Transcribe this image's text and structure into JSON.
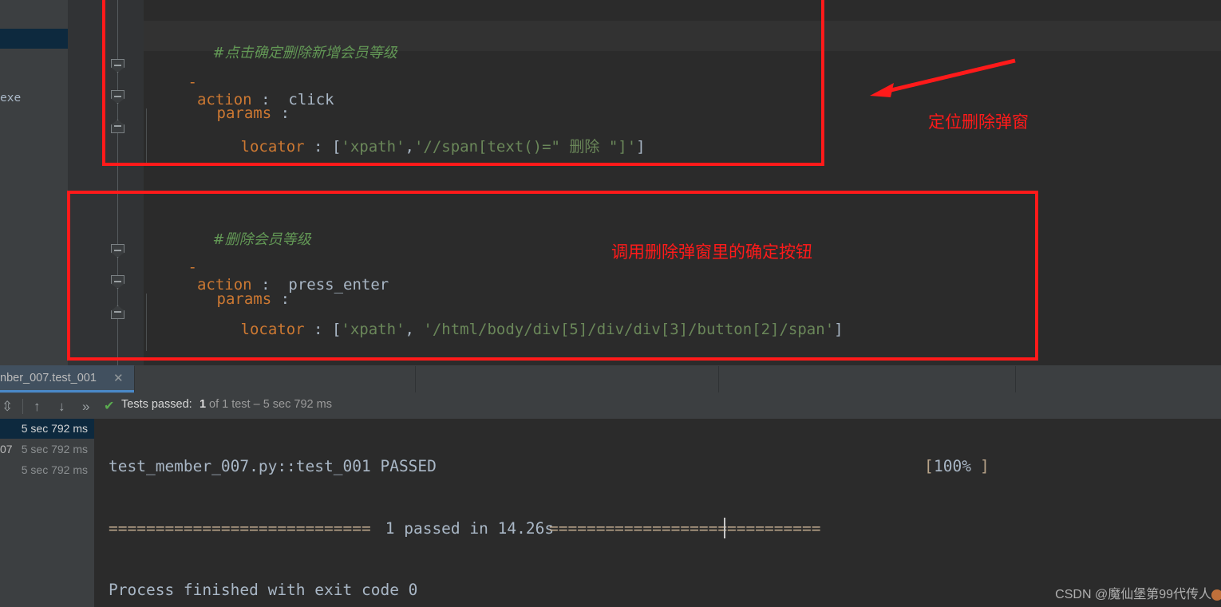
{
  "editor": {
    "left_panel_text": "exe",
    "blocks": [
      {
        "comment": "#点击确定删除新增会员等级",
        "action_key": "action",
        "action_colon": ":",
        "action_value": "click",
        "params_key": "params",
        "params_colon": ":",
        "locator_key": "locator",
        "locator_colon": ":",
        "locator_open": "[",
        "locator_type": "'xpath'",
        "locator_sep": ",",
        "locator_value": "'//span[text()=\" 删除 \"]'",
        "locator_close": "]",
        "dash": "-"
      },
      {
        "comment": "#删除会员等级",
        "action_key": "action",
        "action_colon": ":",
        "action_value": "press_enter",
        "params_key": "params",
        "params_colon": ":",
        "locator_key": "locator",
        "locator_colon": ":",
        "locator_open": "[",
        "locator_type": "'xpath'",
        "locator_sep": ", ",
        "locator_value": "'/html/body/div[5]/div/div[3]/button[2]/span'",
        "locator_close": "]",
        "dash": "-"
      }
    ]
  },
  "annotations": {
    "color": "#ff1a1a",
    "label_top": "定位删除弹窗",
    "label_bottom": "调用删除弹窗里的确定按钮",
    "arrow_name": "red-arrow-pointing-left"
  },
  "bottom_panel": {
    "tab": {
      "label": "nber_007.test_001",
      "close_glyph": "✕"
    },
    "toolbar": {
      "collapse_icon": "⇳",
      "up_icon": "↑",
      "down_icon": "↓",
      "next_icon": "»",
      "check_icon": "✔",
      "status_prefix": "Tests passed:",
      "status_count": "1",
      "status_suffix": "of 1 test – 5 sec 792 ms"
    },
    "tree": {
      "rows": [
        {
          "name": "",
          "time": "5 sec 792 ms",
          "selected": true
        },
        {
          "name": "07",
          "time": "5 sec 792 ms",
          "selected": false
        },
        {
          "name": "",
          "time": "5 sec 792 ms",
          "selected": false
        }
      ]
    },
    "console": {
      "line_test": "test_member_007.py::test_001 PASSED",
      "percent_open": "[",
      "percent_value": "100%",
      "percent_close": "]",
      "summary_left_eq": "============================",
      "summary_text": " 1 passed in 14.26s ",
      "summary_right_eq": "=============================",
      "line_process": "Process finished with exit code 0"
    },
    "watermark": "CSDN @魔仙堡第99代传人"
  }
}
